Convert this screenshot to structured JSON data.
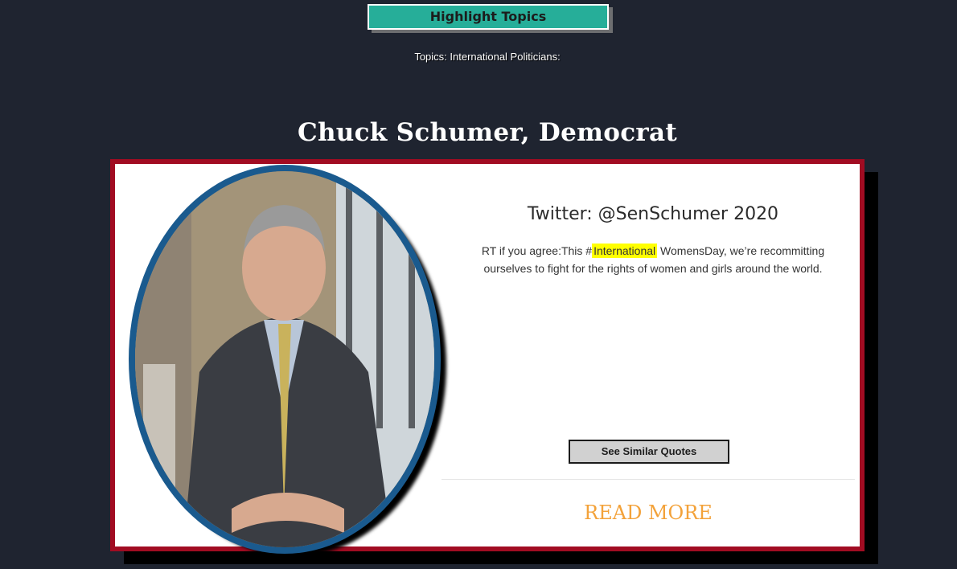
{
  "header": {
    "highlight_button_label": "Highlight Topics",
    "topics_line": "Topics: International Politicians:"
  },
  "politician": {
    "name": "Chuck Schumer, Democrat"
  },
  "tweet": {
    "heading": "Twitter: @SenSchumer 2020",
    "text_before": "RT if you agree:This #",
    "highlighted_word": "International",
    "text_after": "WomensDay, we’re recommitting ourselves to fight for the rights of women and girls around the world."
  },
  "actions": {
    "similar_quotes_label": "See Similar Quotes",
    "read_more_label": "READ MORE"
  },
  "colors": {
    "page_background": "#1f2430",
    "highlight_button": "#26ae99",
    "card_border": "#a10c22",
    "portrait_ring": "#1a5a8e",
    "highlight": "#ffff00",
    "read_more": "#f3a23a"
  }
}
